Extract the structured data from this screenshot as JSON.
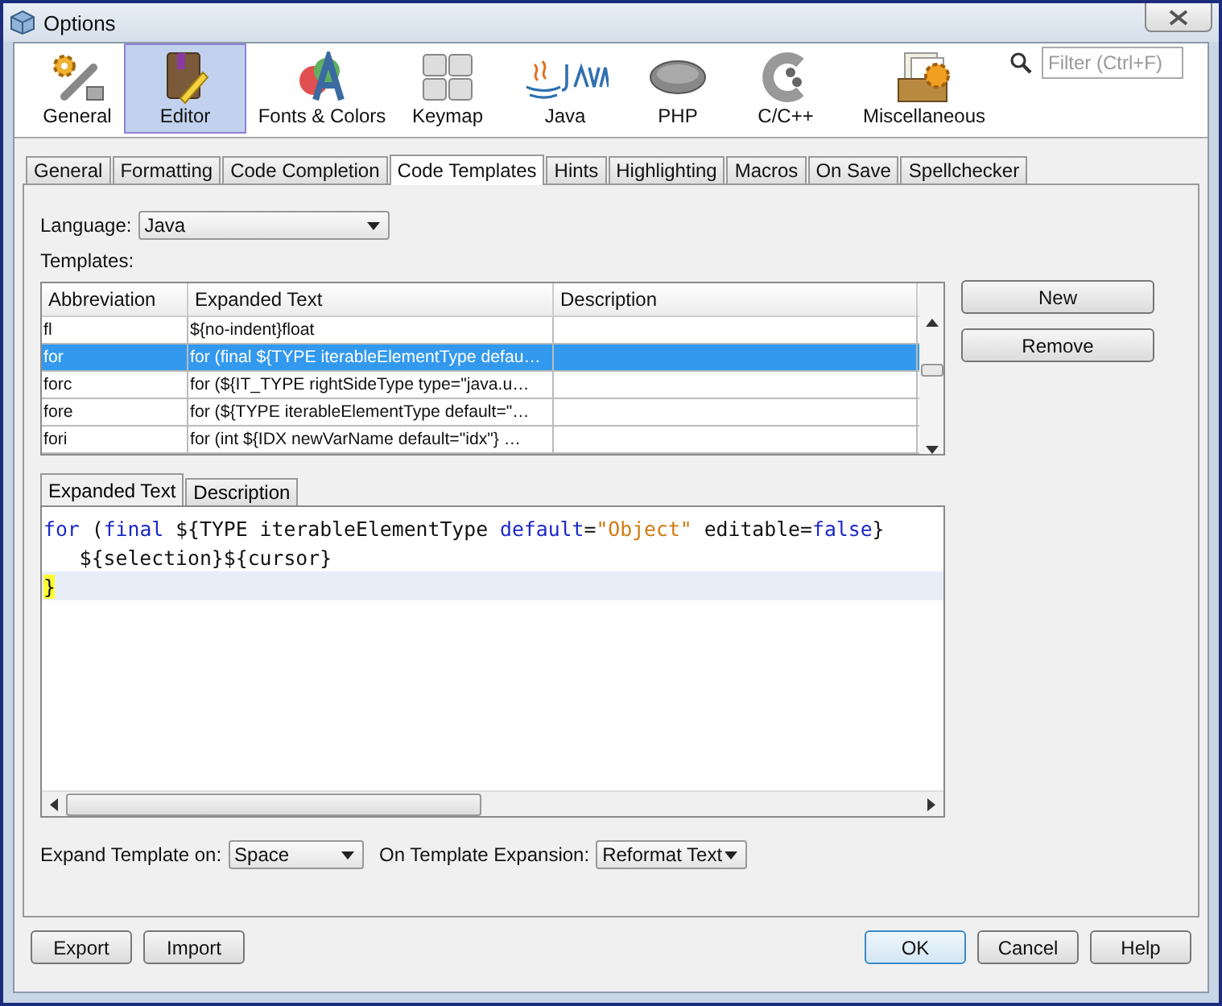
{
  "window": {
    "title": "Options"
  },
  "categories": [
    {
      "label": "General",
      "kind": "gears",
      "selected": false
    },
    {
      "label": "Editor",
      "kind": "book",
      "selected": true
    },
    {
      "label": "Fonts & Colors",
      "kind": "fonts",
      "selected": false
    },
    {
      "label": "Keymap",
      "kind": "keys",
      "selected": false
    },
    {
      "label": "Java",
      "kind": "java",
      "selected": false
    },
    {
      "label": "PHP",
      "kind": "php",
      "selected": false
    },
    {
      "label": "C/C++",
      "kind": "cpp",
      "selected": false
    },
    {
      "label": "Miscellaneous",
      "kind": "misc",
      "selected": false
    }
  ],
  "filter": {
    "placeholder": "Filter (Ctrl+F)"
  },
  "tabs": [
    {
      "label": "General",
      "selected": false
    },
    {
      "label": "Formatting",
      "selected": false
    },
    {
      "label": "Code Completion",
      "selected": false
    },
    {
      "label": "Code Templates",
      "selected": true
    },
    {
      "label": "Hints",
      "selected": false
    },
    {
      "label": "Highlighting",
      "selected": false
    },
    {
      "label": "Macros",
      "selected": false
    },
    {
      "label": "On Save",
      "selected": false
    },
    {
      "label": "Spellchecker",
      "selected": false
    }
  ],
  "language": {
    "label": "Language:",
    "value": "Java"
  },
  "templates_label": "Templates:",
  "table": {
    "columns": [
      "Abbreviation",
      "Expanded Text",
      "Description"
    ],
    "rows": [
      {
        "cells": [
          "fl",
          "${no-indent}float",
          ""
        ],
        "selected": false
      },
      {
        "cells": [
          "for",
          "for (final ${TYPE iterableElementType defau…",
          ""
        ],
        "selected": true
      },
      {
        "cells": [
          "forc",
          "for (${IT_TYPE rightSideType type=\"java.u…",
          ""
        ],
        "selected": false
      },
      {
        "cells": [
          "fore",
          "for (${TYPE iterableElementType default=\"…",
          ""
        ],
        "selected": false
      },
      {
        "cells": [
          "fori",
          "for (int ${IDX newVarName default=\"idx\"} …",
          ""
        ],
        "selected": false
      }
    ]
  },
  "side_buttons": [
    "New",
    "Remove"
  ],
  "editor_tabs": [
    {
      "label": "Expanded Text",
      "selected": true
    },
    {
      "label": "Description",
      "selected": false
    }
  ],
  "code_lines": [
    {
      "current": false,
      "tokens": [
        {
          "text": "for",
          "kind": "keyword"
        },
        {
          "text": " (",
          "kind": "plain"
        },
        {
          "text": "final",
          "kind": "keyword"
        },
        {
          "text": " ${TYPE iterableElementType ",
          "kind": "plain"
        },
        {
          "text": "default",
          "kind": "keyword"
        },
        {
          "text": "=",
          "kind": "plain"
        },
        {
          "text": "\"Object\"",
          "kind": "string"
        },
        {
          "text": " editable=",
          "kind": "plain"
        },
        {
          "text": "false",
          "kind": "keyword"
        },
        {
          "text": "}",
          "kind": "plain"
        }
      ]
    },
    {
      "current": false,
      "tokens": [
        {
          "text": "   ${selection}${cursor}",
          "kind": "plain"
        }
      ]
    },
    {
      "current": true,
      "tokens": [
        {
          "text": "}",
          "kind": "match"
        }
      ]
    }
  ],
  "expand_on": {
    "label": "Expand Template on:",
    "value": "Space"
  },
  "on_expansion": {
    "label": "On Template Expansion:",
    "value": "Reformat Text"
  },
  "footer_left": [
    "Export",
    "Import"
  ],
  "footer_right": [
    {
      "label": "OK",
      "default": true
    },
    {
      "label": "Cancel",
      "default": false
    },
    {
      "label": "Help",
      "default": false
    }
  ]
}
